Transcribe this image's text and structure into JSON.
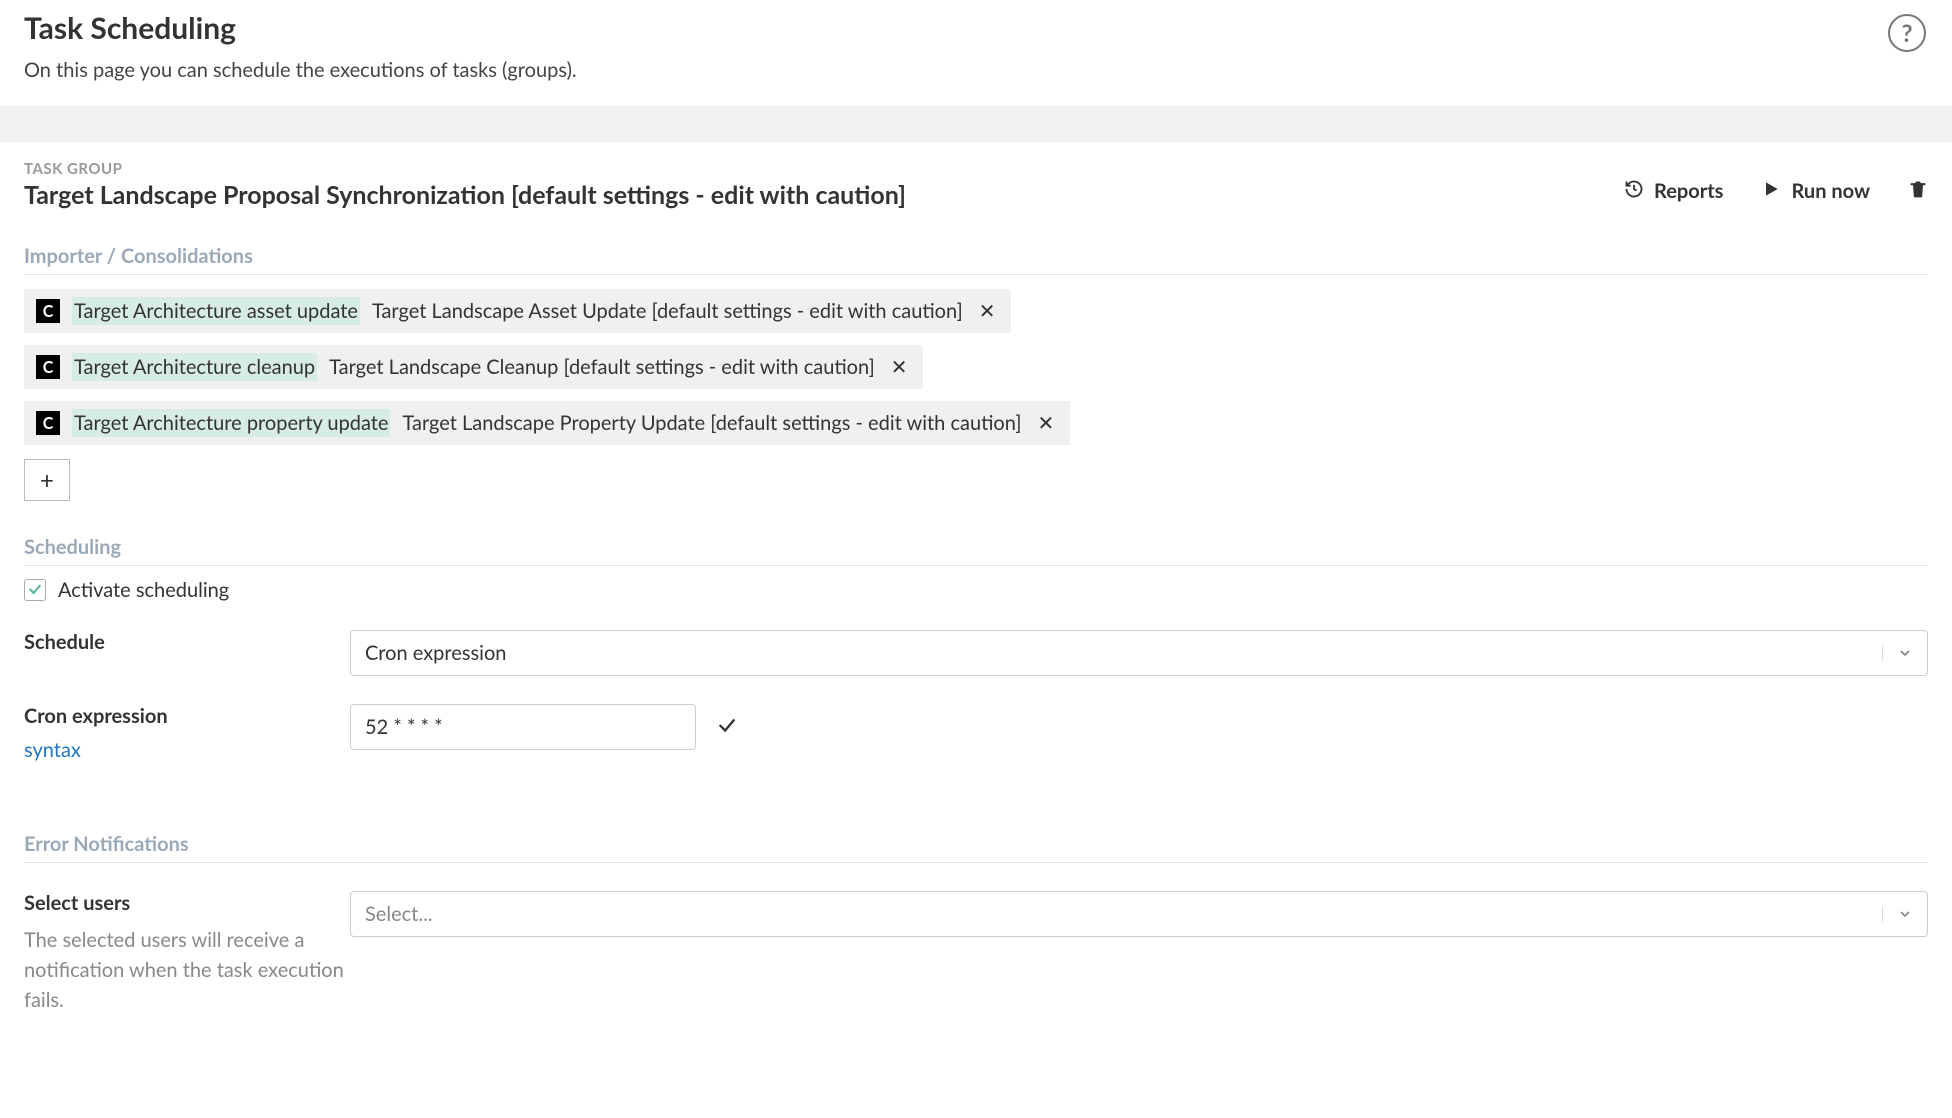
{
  "header": {
    "title": "Task Scheduling",
    "subtitle": "On this page you can schedule the executions of tasks (groups)."
  },
  "taskGroup": {
    "eyebrow": "TASK GROUP",
    "name": "Target Landscape Proposal Synchronization [default settings - edit with caution]",
    "actions": {
      "reports": "Reports",
      "runNow": "Run now"
    }
  },
  "importer": {
    "title": "Importer / Consolidations",
    "items": [
      {
        "icon": "C",
        "primary": "Target Architecture asset update",
        "secondary": "Target Landscape Asset Update [default settings - edit with caution]"
      },
      {
        "icon": "C",
        "primary": "Target Architecture cleanup",
        "secondary": "Target Landscape Cleanup [default settings - edit with caution]"
      },
      {
        "icon": "C",
        "primary": "Target Architecture property update",
        "secondary": "Target Landscape Property Update [default settings - edit with caution]"
      }
    ]
  },
  "scheduling": {
    "title": "Scheduling",
    "checkboxLabel": "Activate scheduling",
    "scheduleLabel": "Schedule",
    "scheduleValue": "Cron expression",
    "cronLabel": "Cron expression",
    "cronValue": "52 * * * *",
    "syntaxLink": "syntax"
  },
  "errorNotifications": {
    "title": "Error Notifications",
    "selectUsersLabel": "Select users",
    "selectUsersPlaceholder": "Select...",
    "selectUsersHelp": "The selected users will receive a notification when the task execution fails."
  }
}
